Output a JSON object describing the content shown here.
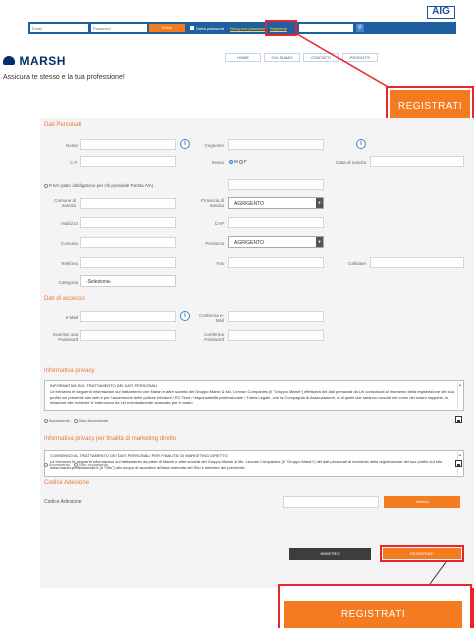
{
  "topbar": {
    "brand_logo": "AIG",
    "email_placeholder": "Email",
    "password_placeholder": "Password",
    "login_button": "Entra",
    "save_password_label": "Salva password",
    "recover_password_link": "Recupera password",
    "register_link": "Registrati"
  },
  "header": {
    "logo_text": "MARSH",
    "nav": [
      "HOME",
      "CHI SIAMO",
      "CONTATTI",
      "PRODOTTI"
    ],
    "tagline": "Assicura te stesso e la tua professione!"
  },
  "callout_top_label": "REGISTRATI",
  "personal": {
    "title": "Dati Personali",
    "nome": "Nome",
    "cognome": "Cognome",
    "cf": "C.F.",
    "sesso": "Sesso",
    "sex_options": [
      "M",
      "F"
    ],
    "data_nascita": "Data di nascita",
    "piva": "P.IVA (dato obbligatorio per chi possiede Partita IVA)",
    "comune_nascita": "Comune di nascita",
    "provincia_nascita": "Provincia di nascita",
    "provincia_nascita_value": "AGRIGENTO",
    "indirizzo": "Indirizzo",
    "cap": "CAP",
    "comune": "Comune",
    "provincia": "Provincia",
    "provincia_value": "AGRIGENTO",
    "telefono": "Telefono",
    "fax": "Fax",
    "cellulare": "Cellulare",
    "categoria": "Categoria",
    "categoria_value": "-Seleziona-"
  },
  "access": {
    "title": "Dati di accesso",
    "email": "e-Mail",
    "conferma_email": "Conferma e-Mail",
    "password": "Inserisci una Password",
    "conferma_password": "Conferma Password"
  },
  "privacy": {
    "title": "Informativa privacy",
    "heading": "INFORMATIVA SUL TRATTAMENTO DEI DATI PERSONALI",
    "body": "Le forniamo le seguenti informazioni sul trattamento che Marsh e altre società del Gruppo Marsh & Mc. Lennan Companies (il \"Gruppo Marsh\") effettuerà dei dati personali da Lei comunicati al momento della registrazione del suo profilo sul presente sito web e per l'accensione delle polizze Infortuni / RC Terzi / responsabilità professionale / Tutela Legale, con la Compagnia di Assicurazione, e di quelli che saranno raccolti nel corso del nostro rapporto, in relazione alle richieste d' indennizzo da Lei eventualmente avanzate per il nostro",
    "accept": "Acconsento",
    "decline": "Non Acconsento"
  },
  "marketing": {
    "title": "Informativa privacy per finalità di marketing diretto",
    "heading": "CONSENSO AL TRATTAMENTO DEI DATI PERSONALI PER FINALITA' DI MARKETING DIRETTO",
    "body": "Le forniamo le seguenti informazioni sul trattamento da parte di Marsh e altre società del Gruppo Marsh & Mc. Lennan Companies (il \"Gruppo Marsh\") dei dati personali al momento della registrazione del suo profilo sul sito www.marsh-professionisti.it (il \"Sito\") allo scopo di accedere all'area riservata del Sito e ottenere dei preventivi.",
    "accept": "Acconsento",
    "decline": "Non acconsento"
  },
  "adhesion": {
    "title": "Codice Adesione",
    "label": "Codice Adesione",
    "verify_button": "Verifica"
  },
  "actions": {
    "back": "INDIETRO",
    "register": "REGISTRATI"
  },
  "callout_bottom_label": "REGISTRATI",
  "colors": {
    "accent": "#f47b20",
    "highlight": "#e8252b",
    "dark_button": "#3d3d3d",
    "marsh_blue": "#00306b"
  }
}
